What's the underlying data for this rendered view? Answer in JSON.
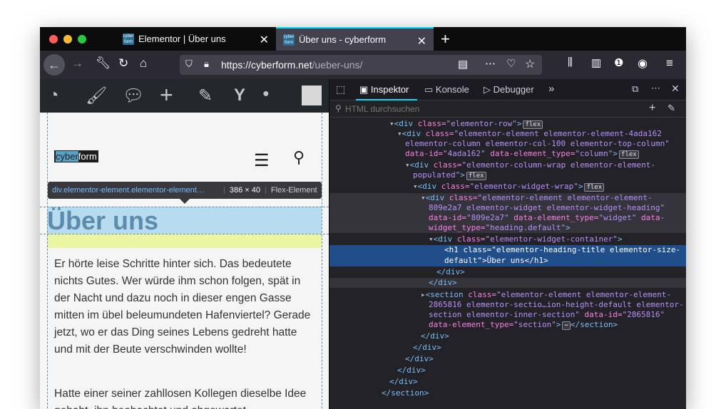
{
  "tabs": [
    {
      "favicon": "cyber form",
      "title": "Elementor | Über uns"
    },
    {
      "favicon": "cyber form",
      "title": "Über uns - cyberform"
    }
  ],
  "url": {
    "host": "https://cyberform.net",
    "path": "/ueber-uns/"
  },
  "site": {
    "logo_a": "cyber",
    "logo_b": "form"
  },
  "tooltip": {
    "selector": "div.elementor-element.elementor-element…",
    "size": "386 × 40",
    "type": "Flex-Element"
  },
  "page": {
    "heading": "Über uns",
    "para1": "Er hörte leise Schritte hinter sich. Das bedeutete nichts Gutes. Wer würde ihm schon folgen, spät in der Nacht und dazu noch in dieser engen Gasse mitten im übel beleumundeten Hafenviertel? Gerade jetzt, wo er das Ding seines Lebens gedreht hatte und mit der Beute verschwinden wollte!",
    "para2": "Hatte einer seiner zahllosen Kollegen dieselbe Idee gehabt, ihn beobachtet und abgewartet,"
  },
  "devtools": {
    "tabs": {
      "inspector": "Inspektor",
      "console": "Konsole",
      "debugger": "Debugger"
    },
    "search_placeholder": "HTML durchsuchen",
    "flex_badge": "flex",
    "ellipsis_badge": "⋯"
  },
  "colors": {
    "accent": "#00ddff",
    "selection": "#204e8a",
    "heading": "#5c8cab"
  }
}
